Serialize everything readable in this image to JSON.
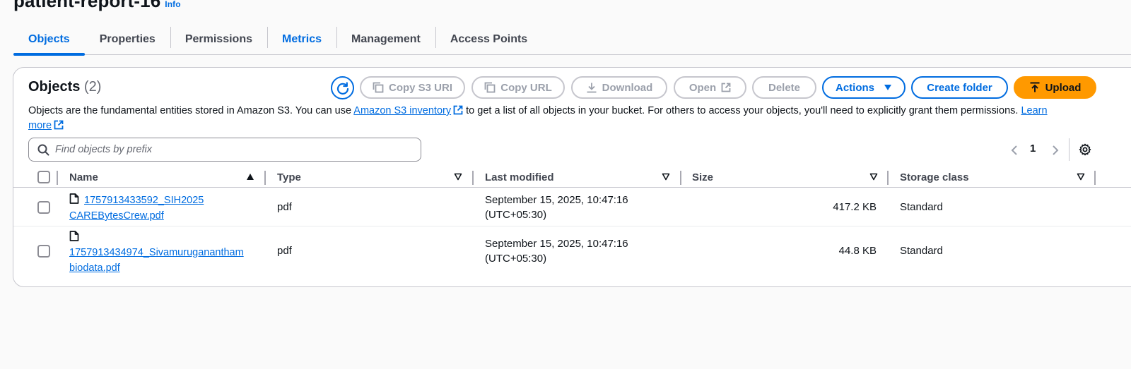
{
  "page": {
    "title": "patient-report-16",
    "info_label": "Info"
  },
  "tabs": [
    {
      "label": "Objects",
      "active": true
    },
    {
      "label": "Properties"
    },
    {
      "label": "Permissions"
    },
    {
      "label": "Metrics"
    },
    {
      "label": "Management"
    },
    {
      "label": "Access Points"
    }
  ],
  "objects_panel": {
    "title": "Objects",
    "count": "(2)",
    "buttons": {
      "copy_s3_uri": "Copy S3 URI",
      "copy_url": "Copy URL",
      "download": "Download",
      "open": "Open",
      "delete": "Delete",
      "actions": "Actions",
      "create_folder": "Create folder",
      "upload": "Upload"
    },
    "description": {
      "part1": "Objects are the fundamental entities stored in Amazon S3. You can use ",
      "link1": "Amazon S3 inventory",
      "part2": " to get a list of all objects in your bucket. For others to access your objects, you'll need to explicitly grant them permissions. ",
      "link2a": "Learn",
      "link2b": "more"
    },
    "search": {
      "placeholder": "Find objects by prefix",
      "value": ""
    },
    "pagination": {
      "current_page": "1"
    },
    "columns": {
      "name": "Name",
      "type": "Type",
      "last_modified": "Last modified",
      "size": "Size",
      "storage_class": "Storage class"
    },
    "rows": [
      {
        "name_line1": "1757913433592_SIH2025",
        "name_line2": "CAREBytesCrew.pdf",
        "type": "pdf",
        "modified_line1": "September 15, 2025, 10:47:16",
        "modified_line2": "(UTC+05:30)",
        "size": "417.2 KB",
        "storage_class": "Standard"
      },
      {
        "name_line1": "1757913434974_Sivamuruganantham",
        "name_line2": "biodata.pdf",
        "type": "pdf",
        "modified_line1": "September 15, 2025, 10:47:16",
        "modified_line2": "(UTC+05:30)",
        "size": "44.8 KB",
        "storage_class": "Standard"
      }
    ]
  },
  "colors": {
    "accent": "#006ce0",
    "upload": "#ff9900",
    "disabled": "#9ba0ab"
  }
}
